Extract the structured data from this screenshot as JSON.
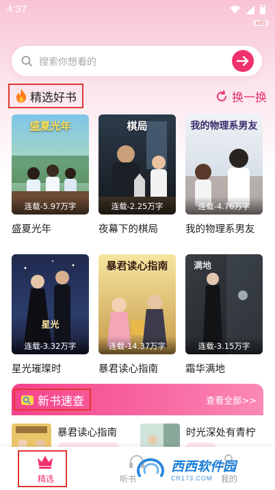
{
  "status": {
    "time": "4:37",
    "badge": "e65"
  },
  "search": {
    "placeholder": "搜索你想看的"
  },
  "featured": {
    "title": "精选好书",
    "refresh_label": "换一换",
    "books": [
      {
        "name": "盛夏光年",
        "status": "连载-5.97万字",
        "cover_title": "盛夏光年"
      },
      {
        "name": "夜幕下的棋局",
        "status": "连载-2.25万字",
        "cover_title": "棋局"
      },
      {
        "name": "我的物理系男友",
        "status": "连载-4.76万字",
        "cover_title": "我的物理系男友"
      },
      {
        "name": "星光璀璨时",
        "status": "连载-3.32万字",
        "cover_title": "星光"
      },
      {
        "name": "暴君读心指南",
        "status": "连载-14.37万字",
        "cover_title": "暴君读心指南"
      },
      {
        "name": "霜华满地",
        "status": "连载-3.15万字",
        "cover_title": "满地"
      }
    ]
  },
  "new_books": {
    "title": "新书速查",
    "see_all": "查看全部>>",
    "items": [
      {
        "name": "暴君读心指南"
      },
      {
        "name": "时光深处有青柠"
      }
    ]
  },
  "nav": {
    "items": [
      {
        "label": "精选"
      },
      {
        "label": "听书"
      },
      {
        "label": "我的"
      }
    ]
  },
  "watermark": {
    "main": "西西软件园",
    "sub": "CR173.COM"
  },
  "colors": {
    "accent": "#f0316c",
    "highlight_box": "#e0352f"
  }
}
